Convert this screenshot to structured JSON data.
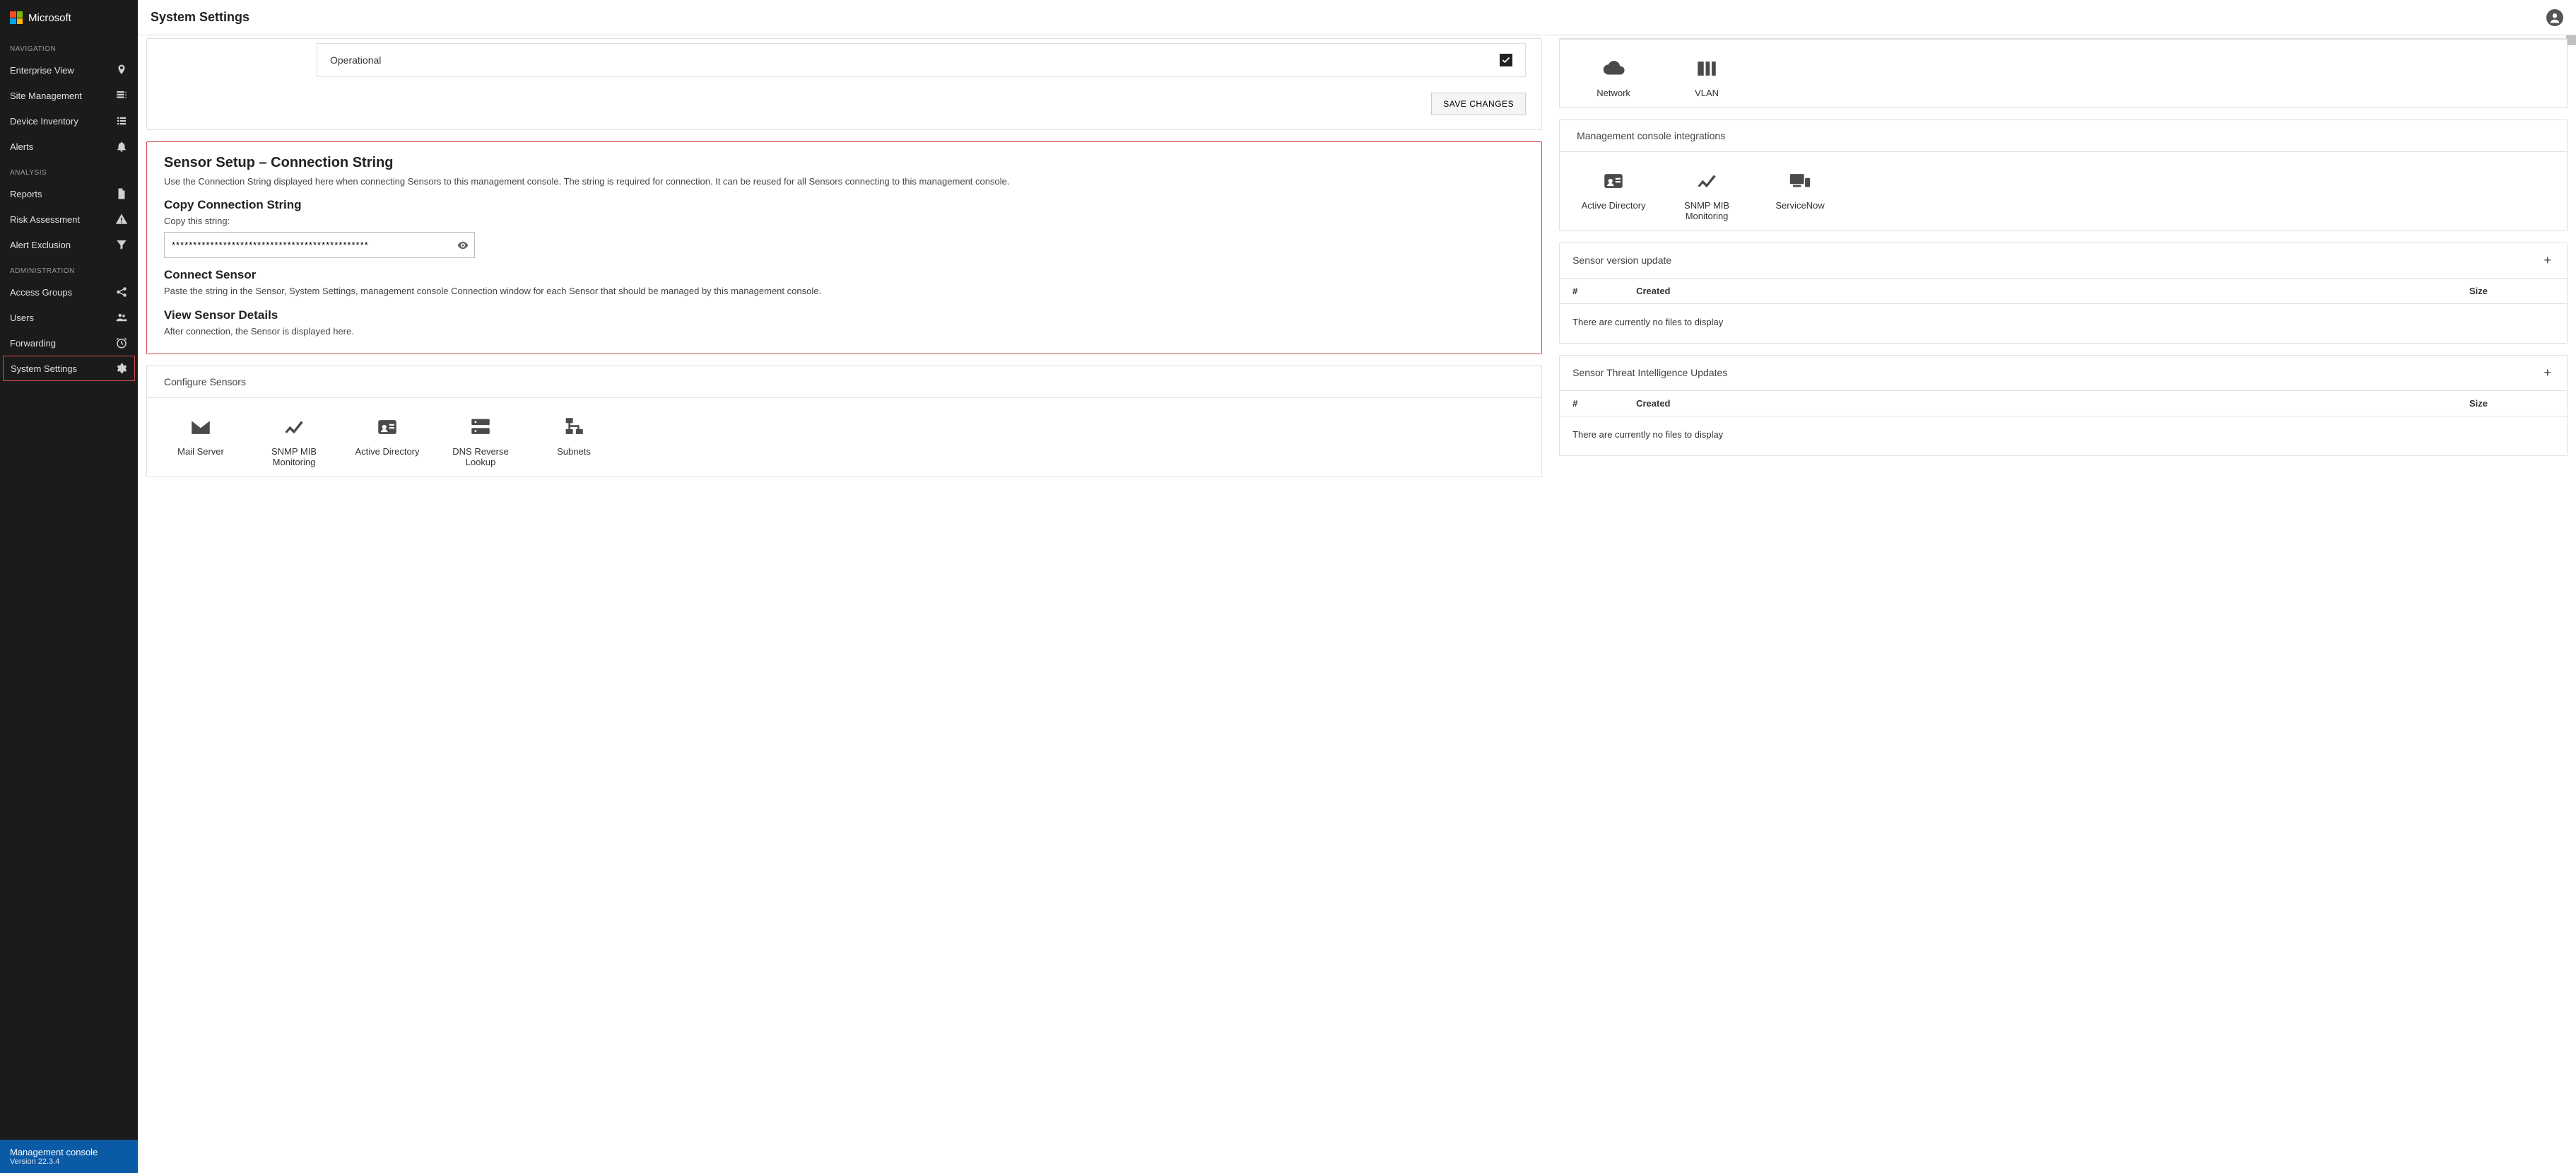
{
  "brand": {
    "name": "Microsoft"
  },
  "header": {
    "title": "System Settings"
  },
  "sidebar": {
    "sections": [
      {
        "label": "NAVIGATION",
        "items": [
          {
            "label": "Enterprise View",
            "icon": "location"
          },
          {
            "label": "Site Management",
            "icon": "site"
          },
          {
            "label": "Device Inventory",
            "icon": "list"
          },
          {
            "label": "Alerts",
            "icon": "bell"
          }
        ]
      },
      {
        "label": "ANALYSIS",
        "items": [
          {
            "label": "Reports",
            "icon": "doc"
          },
          {
            "label": "Risk Assessment",
            "icon": "warn"
          },
          {
            "label": "Alert Exclusion",
            "icon": "filter"
          }
        ]
      },
      {
        "label": "ADMINISTRATION",
        "items": [
          {
            "label": "Access Groups",
            "icon": "share"
          },
          {
            "label": "Users",
            "icon": "group"
          },
          {
            "label": "Forwarding",
            "icon": "clock"
          },
          {
            "label": "System Settings",
            "icon": "gear",
            "active": true
          }
        ]
      }
    ],
    "footer": {
      "line1": "Management console",
      "line2": "Version 22.3.4"
    }
  },
  "operational": {
    "label": "Operational",
    "checked": true
  },
  "save_button": "SAVE CHANGES",
  "sensor_setup": {
    "title": "Sensor Setup – Connection String",
    "intro": "Use the Connection String displayed here when connecting Sensors to this management console. The string is required for connection. It can be reused for all Sensors connecting to this management console.",
    "copy_h": "Copy Connection String",
    "copy_label": "Copy this string:",
    "value": "**********************************************",
    "connect_h": "Connect Sensor",
    "connect_p": "Paste the string in the Sensor, System Settings, management console Connection window for each Sensor that should be managed by this management console.",
    "view_h": "View Sensor Details",
    "view_p": "After connection, the Sensor is displayed here."
  },
  "configure_sensors": {
    "title": "Configure Sensors",
    "tiles": [
      {
        "label": "Mail Server",
        "icon": "mail"
      },
      {
        "label": "SNMP MIB Monitoring",
        "icon": "chart"
      },
      {
        "label": "Active Directory",
        "icon": "badge"
      },
      {
        "label": "DNS Reverse Lookup",
        "icon": "dns"
      },
      {
        "label": "Subnets",
        "icon": "subnet"
      }
    ]
  },
  "right_top_tiles": [
    {
      "label": "Network",
      "icon": "cloud"
    },
    {
      "label": "VLAN",
      "icon": "vlan"
    }
  ],
  "integrations": {
    "title": "Management console integrations",
    "tiles": [
      {
        "label": "Active Directory",
        "icon": "badge"
      },
      {
        "label": "SNMP MIB Monitoring",
        "icon": "chart"
      },
      {
        "label": "ServiceNow",
        "icon": "devices"
      }
    ]
  },
  "panels": [
    {
      "title": "Sensor version update",
      "cols": [
        "#",
        "Created",
        "Size"
      ],
      "empty": "There are currently no files to display"
    },
    {
      "title": "Sensor Threat Intelligence Updates",
      "cols": [
        "#",
        "Created",
        "Size"
      ],
      "empty": "There are currently no files to display"
    }
  ]
}
